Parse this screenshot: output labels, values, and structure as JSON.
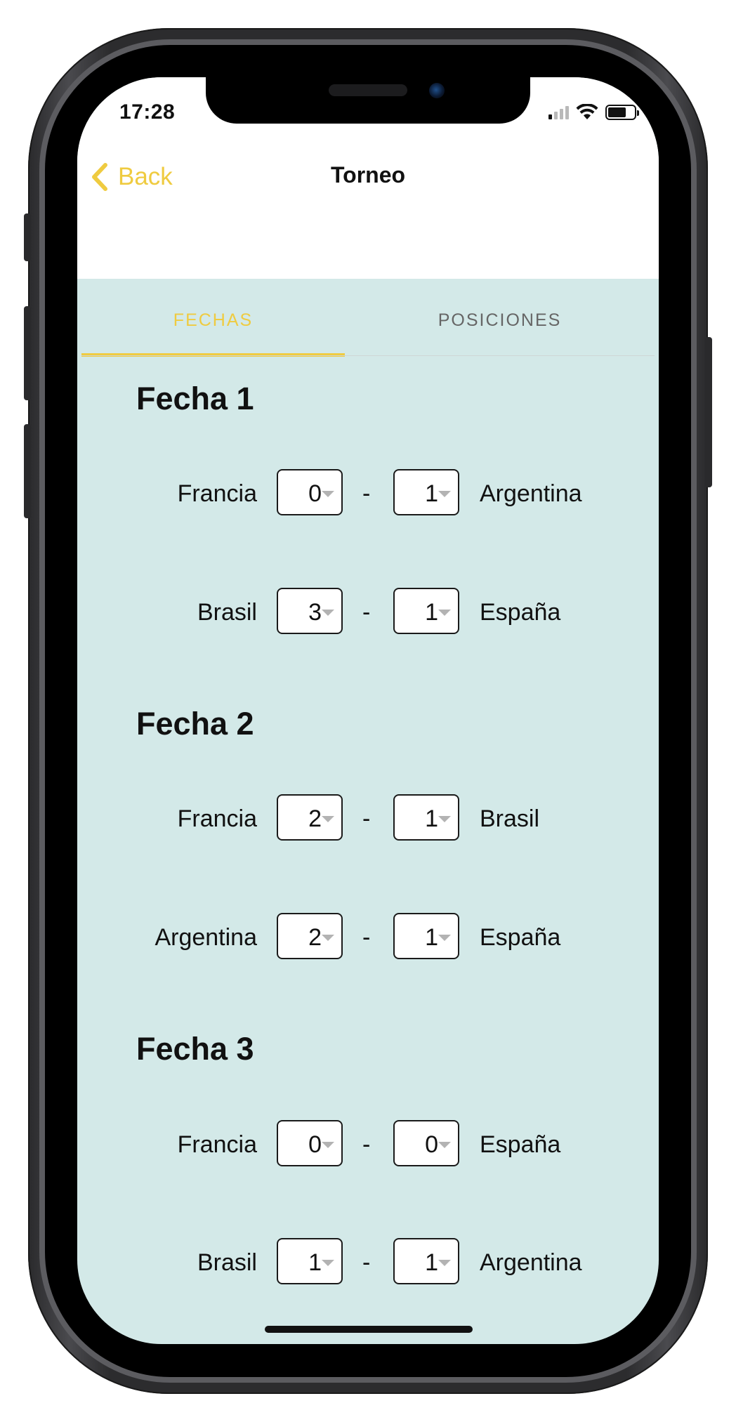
{
  "status": {
    "time": "17:28"
  },
  "nav": {
    "back_label": "Back",
    "title": "Torneo"
  },
  "tabs": [
    {
      "label": "FECHAS",
      "active": true
    },
    {
      "label": "POSICIONES",
      "active": false
    }
  ],
  "colors": {
    "accent": "#efcb40",
    "background": "#d3e9e8"
  },
  "fechas": [
    {
      "title": "Fecha 1",
      "matches": [
        {
          "home": "Francia",
          "home_score": "0",
          "away_score": "1",
          "away": "Argentina"
        },
        {
          "home": "Brasil",
          "home_score": "3",
          "away_score": "1",
          "away": "España"
        }
      ]
    },
    {
      "title": "Fecha 2",
      "matches": [
        {
          "home": "Francia",
          "home_score": "2",
          "away_score": "1",
          "away": "Brasil"
        },
        {
          "home": "Argentina",
          "home_score": "2",
          "away_score": "1",
          "away": "España"
        }
      ]
    },
    {
      "title": "Fecha 3",
      "matches": [
        {
          "home": "Francia",
          "home_score": "0",
          "away_score": "0",
          "away": "España"
        },
        {
          "home": "Brasil",
          "home_score": "1",
          "away_score": "1",
          "away": "Argentina"
        }
      ]
    }
  ],
  "separator": "-"
}
